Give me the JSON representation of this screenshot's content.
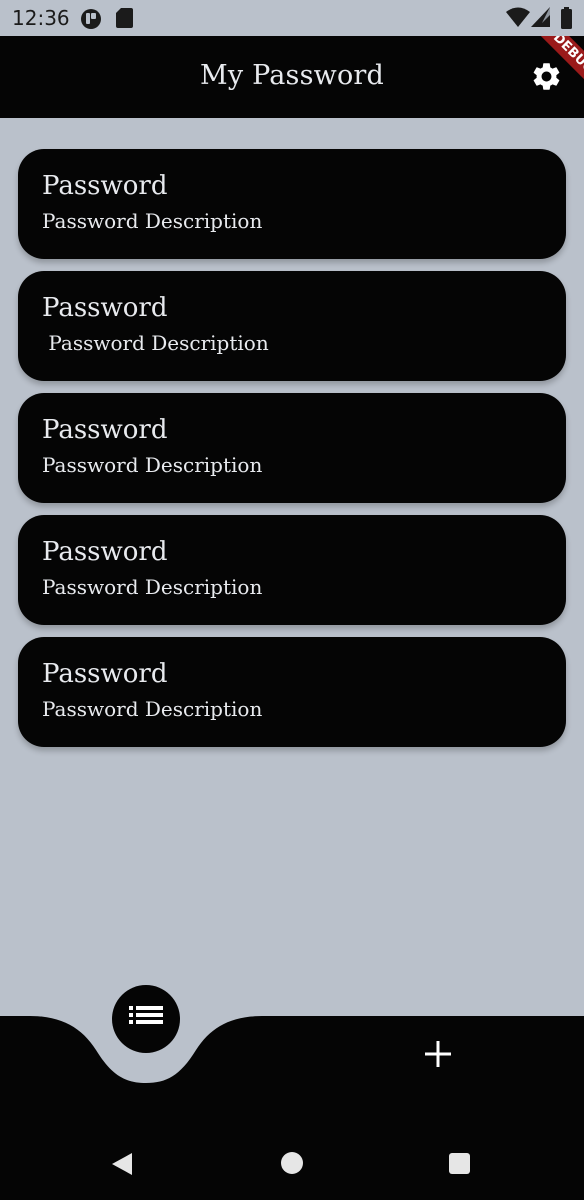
{
  "status_bar": {
    "time": "12:36",
    "icons_left": [
      "circle-app-icon",
      "sd-card-icon"
    ],
    "icons_right": [
      "wifi-icon",
      "cell-signal-icon",
      "battery-icon"
    ]
  },
  "app_bar": {
    "title": "My Password",
    "settings_icon": "gear-icon",
    "debug_banner": "DEBUG"
  },
  "passwords": [
    {
      "title": "Password",
      "description": "Password Description"
    },
    {
      "title": "Password",
      "description": " Password Description"
    },
    {
      "title": "Password",
      "description": "Password Description"
    },
    {
      "title": "Password",
      "description": "Password Description"
    },
    {
      "title": "Password",
      "description": "Password Description"
    }
  ],
  "bottom_nav": {
    "items": [
      {
        "icon": "list-icon",
        "active": true
      },
      {
        "icon": "plus-icon",
        "active": false
      }
    ]
  },
  "system_nav": {
    "icons": [
      "back-icon",
      "home-icon",
      "recents-icon"
    ]
  },
  "colors": {
    "background": "#bac1cb",
    "surface": "#050505",
    "text_on_surface": "#e8eaee",
    "debug_banner": "#9a1a1a"
  }
}
